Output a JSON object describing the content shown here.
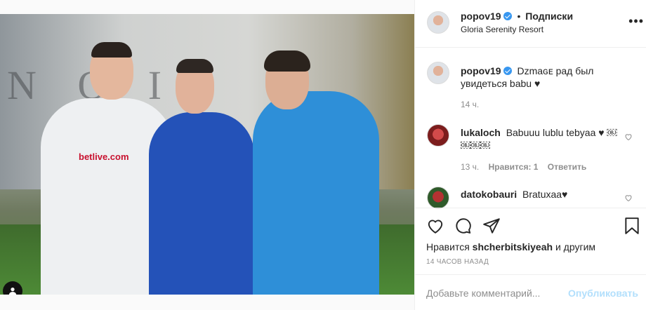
{
  "photo": {
    "sponsor_text": "betlive.com",
    "bg_lettering": "N  O  IA"
  },
  "header": {
    "username": "popov19",
    "follow_label": "Подписки",
    "separator": "•",
    "location": "Gloria Serenity Resort",
    "more_icon": "more-horizontal-icon"
  },
  "caption": {
    "username": "popov19",
    "text": "Dzmaɢᴇ рад был увидеться babu ♥",
    "time": "14 ч."
  },
  "comments": [
    {
      "username": "lukaloch",
      "text": "Babuuu lublu tebyaa ♥ ￼￼￼￼",
      "time": "13 ч.",
      "likes_label": "Нравится: 1",
      "reply_label": "Ответить"
    },
    {
      "username": "datokobauri",
      "text": "Bratuxaa♥"
    }
  ],
  "actions": {
    "like_icon": "heart-icon",
    "comment_icon": "comment-icon",
    "share_icon": "share-icon",
    "save_icon": "bookmark-icon",
    "likes_prefix": "Нравится",
    "likes_user": "shcherbitskiyeah",
    "likes_suffix": "и другим",
    "timestamp": "14 часов назад"
  },
  "add_comment": {
    "placeholder": "Добавьте комментарий...",
    "post_label": "Опубликовать"
  },
  "colors": {
    "accent": "#3897f0",
    "post_disabled": "#b2dffc",
    "muted": "#8e8e8e"
  }
}
